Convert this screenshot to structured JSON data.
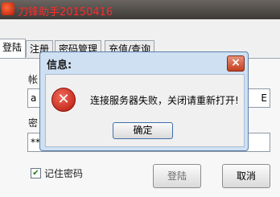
{
  "app": {
    "title": "刀锋助手20150416"
  },
  "tabs": [
    {
      "label": "登陆"
    },
    {
      "label": "注册"
    },
    {
      "label": "密码管理"
    },
    {
      "label": "充值/查询"
    }
  ],
  "login": {
    "account_label": "帐",
    "password_label": "密",
    "account_value": "a",
    "password_value": "**",
    "remember_label": "记住密码",
    "remember_checked": true,
    "login_button": "登陆",
    "cancel_button": "取消",
    "field_right_edge": "E",
    "field_right_edge2": "!"
  },
  "dialog": {
    "title": "信息:",
    "message": "连接服务器失败，关闭请重新打开!",
    "ok_button": "确定",
    "icon": "error-icon",
    "close_icon": "close-icon"
  }
}
